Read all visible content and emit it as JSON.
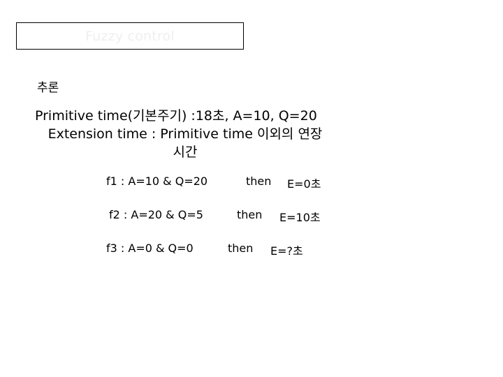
{
  "slide": {
    "title": "Fuzzy control",
    "title_color": "#efefef",
    "border_color": "#000000",
    "background": "#ffffff",
    "section_heading": "추론",
    "definition": {
      "line1": "Primitive time(기본주기) :18초,  A=10, Q=20",
      "line2": "Extension time : Primitive time 이외의 연장",
      "line3": "시간"
    },
    "rules": [
      {
        "antecedent": "f1 : A=10  &  Q=20",
        "connector": "then",
        "consequent": "E=0초"
      },
      {
        "antecedent": "f2 : A=20  &  Q=5",
        "connector": "then",
        "consequent": "E=10초"
      },
      {
        "antecedent": "f3 : A=0  &  Q=0",
        "connector": "then",
        "consequent": "E=?초"
      }
    ]
  }
}
